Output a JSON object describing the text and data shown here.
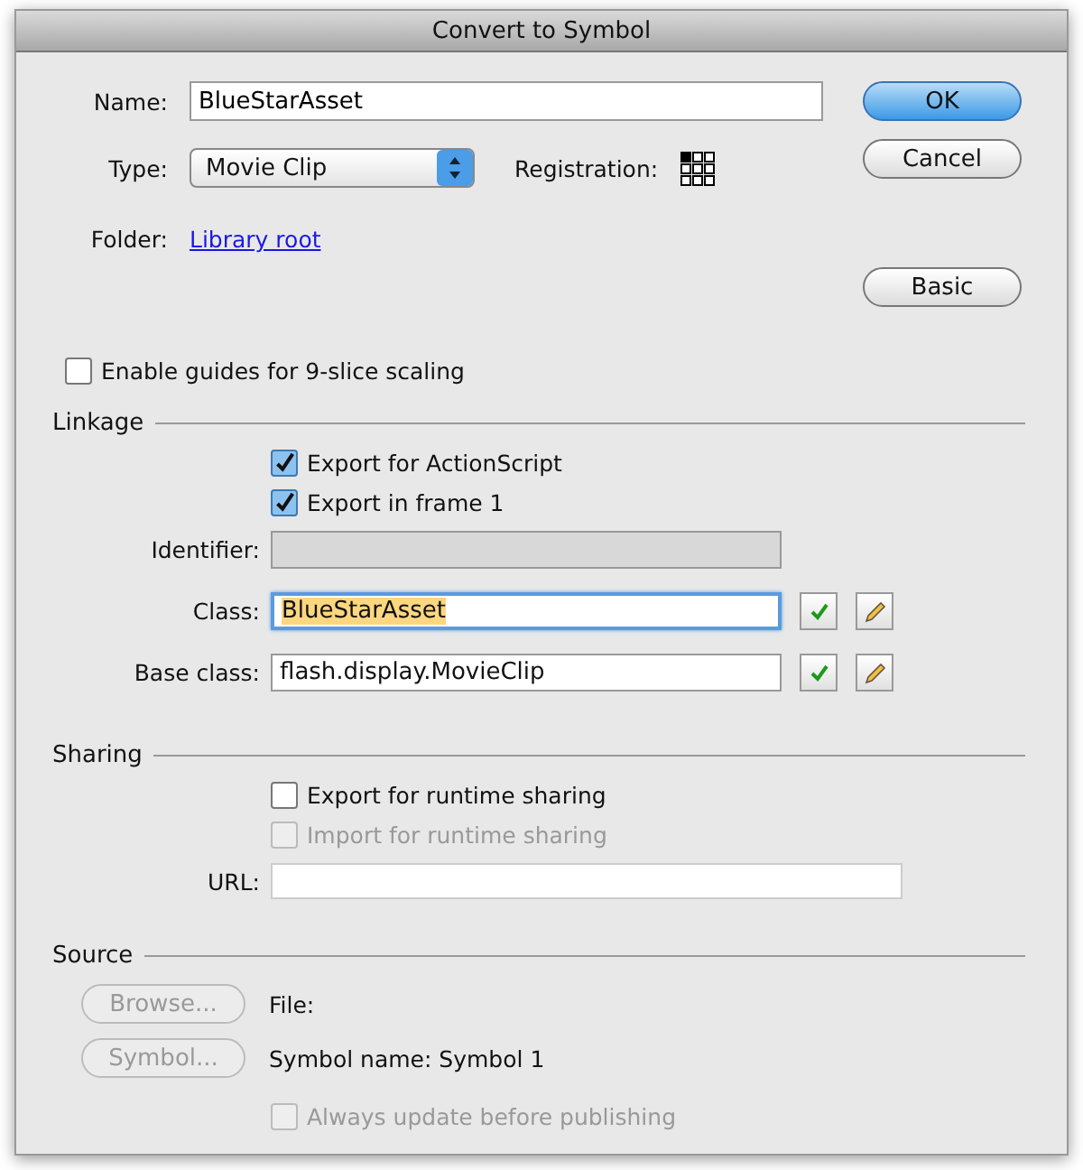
{
  "window": {
    "title": "Convert to Symbol"
  },
  "name": {
    "label": "Name:",
    "value": "BlueStarAsset"
  },
  "type": {
    "label": "Type:",
    "value": "Movie Clip"
  },
  "registration": {
    "label": "Registration:"
  },
  "folder": {
    "label": "Folder:",
    "link": "Library root"
  },
  "buttons": [
    {
      "label": "OK",
      "default": true
    },
    {
      "label": "Cancel",
      "default": false
    },
    {
      "label": "Basic",
      "default": false
    }
  ],
  "nine_slice": {
    "label": "Enable guides for 9-slice scaling",
    "checked": false,
    "disabled": false
  },
  "linkage": {
    "heading": "Linkage",
    "checkboxes": [
      {
        "label": "Export for ActionScript",
        "checked": true,
        "disabled": false
      },
      {
        "label": "Export in frame 1",
        "checked": true,
        "disabled": false
      }
    ],
    "fields": [
      {
        "label": "Identifier:",
        "disabled": true,
        "focused": false,
        "tools": false
      },
      {
        "label": "Class:",
        "value": "BlueStarAsset",
        "disabled": false,
        "focused": true,
        "tools": true
      },
      {
        "label": "Base class:",
        "value": "flash.display.MovieClip",
        "disabled": false,
        "focused": false,
        "tools": true
      }
    ]
  },
  "sharing": {
    "heading": "Sharing",
    "checkboxes": [
      {
        "label": "Export for runtime sharing",
        "checked": false,
        "disabled": false
      },
      {
        "label": "Import for runtime sharing",
        "checked": false,
        "disabled": true
      }
    ],
    "url": {
      "label": "URL:"
    }
  },
  "source": {
    "heading": "Source",
    "rows": [
      {
        "button": "Browse...",
        "disabled": true,
        "text": "File:"
      },
      {
        "button": "Symbol...",
        "disabled": true,
        "text": "Symbol name: Symbol 1"
      }
    ],
    "checkbox": {
      "label": "Always update before publishing",
      "checked": false,
      "disabled": true
    }
  }
}
